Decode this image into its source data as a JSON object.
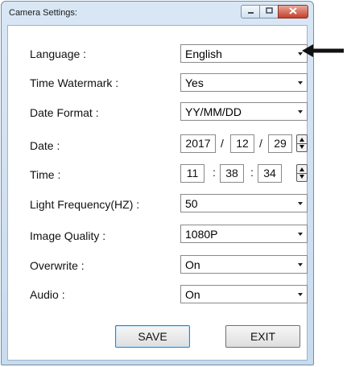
{
  "window": {
    "title": "Camera Settings:"
  },
  "fields": [
    {
      "label": "Language :",
      "value": "English"
    },
    {
      "label": "Time Watermark :",
      "value": "Yes"
    },
    {
      "label": "Date Format :",
      "value": "YY/MM/DD"
    },
    {
      "label": "Date :",
      "parts": [
        "2017",
        "12",
        "29"
      ],
      "separator": "/"
    },
    {
      "label": "Time :",
      "parts": [
        "11",
        "38",
        "34"
      ],
      "separator": ":"
    },
    {
      "label": "Light Frequency(HZ) :",
      "value": "50"
    },
    {
      "label": "Image Quality :",
      "value": "1080P"
    },
    {
      "label": "Overwrite :",
      "value": "On"
    },
    {
      "label": "Audio :",
      "value": "On"
    }
  ],
  "buttons": {
    "save": "SAVE",
    "exit": "EXIT"
  },
  "icons": {
    "minimize": "minimize-icon",
    "maximize": "maximize-icon",
    "close": "close-icon",
    "pointer": "left-arrow-icon"
  }
}
